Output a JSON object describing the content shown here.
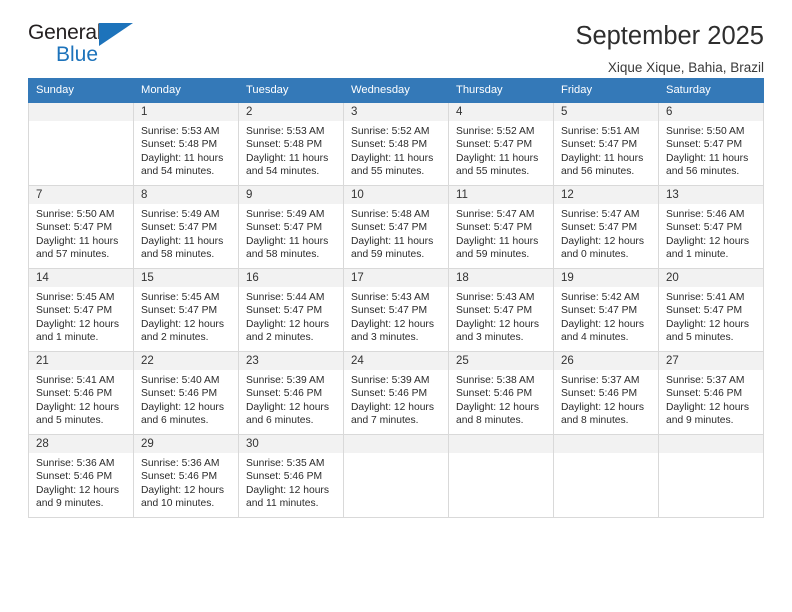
{
  "brand": {
    "name_top": "General",
    "name_bottom": "Blue",
    "triangle_icon": "triangle-icon",
    "accent_color": "#1d73bb"
  },
  "header": {
    "title": "September 2025",
    "subtitle": "Xique Xique, Bahia, Brazil"
  },
  "calendar": {
    "header_bg": "#3479b8",
    "daynum_bg": "#f2f2f2",
    "weekdays": [
      "Sunday",
      "Monday",
      "Tuesday",
      "Wednesday",
      "Thursday",
      "Friday",
      "Saturday"
    ],
    "weeks": [
      [
        {
          "day": "",
          "empty": true,
          "sunrise": "",
          "sunset": "",
          "daylight_1": "",
          "daylight_2": ""
        },
        {
          "day": "1",
          "sunrise": "Sunrise: 5:53 AM",
          "sunset": "Sunset: 5:48 PM",
          "daylight_1": "Daylight: 11 hours",
          "daylight_2": "and 54 minutes."
        },
        {
          "day": "2",
          "sunrise": "Sunrise: 5:53 AM",
          "sunset": "Sunset: 5:48 PM",
          "daylight_1": "Daylight: 11 hours",
          "daylight_2": "and 54 minutes."
        },
        {
          "day": "3",
          "sunrise": "Sunrise: 5:52 AM",
          "sunset": "Sunset: 5:48 PM",
          "daylight_1": "Daylight: 11 hours",
          "daylight_2": "and 55 minutes."
        },
        {
          "day": "4",
          "sunrise": "Sunrise: 5:52 AM",
          "sunset": "Sunset: 5:47 PM",
          "daylight_1": "Daylight: 11 hours",
          "daylight_2": "and 55 minutes."
        },
        {
          "day": "5",
          "sunrise": "Sunrise: 5:51 AM",
          "sunset": "Sunset: 5:47 PM",
          "daylight_1": "Daylight: 11 hours",
          "daylight_2": "and 56 minutes."
        },
        {
          "day": "6",
          "sunrise": "Sunrise: 5:50 AM",
          "sunset": "Sunset: 5:47 PM",
          "daylight_1": "Daylight: 11 hours",
          "daylight_2": "and 56 minutes."
        }
      ],
      [
        {
          "day": "7",
          "sunrise": "Sunrise: 5:50 AM",
          "sunset": "Sunset: 5:47 PM",
          "daylight_1": "Daylight: 11 hours",
          "daylight_2": "and 57 minutes."
        },
        {
          "day": "8",
          "sunrise": "Sunrise: 5:49 AM",
          "sunset": "Sunset: 5:47 PM",
          "daylight_1": "Daylight: 11 hours",
          "daylight_2": "and 58 minutes."
        },
        {
          "day": "9",
          "sunrise": "Sunrise: 5:49 AM",
          "sunset": "Sunset: 5:47 PM",
          "daylight_1": "Daylight: 11 hours",
          "daylight_2": "and 58 minutes."
        },
        {
          "day": "10",
          "sunrise": "Sunrise: 5:48 AM",
          "sunset": "Sunset: 5:47 PM",
          "daylight_1": "Daylight: 11 hours",
          "daylight_2": "and 59 minutes."
        },
        {
          "day": "11",
          "sunrise": "Sunrise: 5:47 AM",
          "sunset": "Sunset: 5:47 PM",
          "daylight_1": "Daylight: 11 hours",
          "daylight_2": "and 59 minutes."
        },
        {
          "day": "12",
          "sunrise": "Sunrise: 5:47 AM",
          "sunset": "Sunset: 5:47 PM",
          "daylight_1": "Daylight: 12 hours",
          "daylight_2": "and 0 minutes."
        },
        {
          "day": "13",
          "sunrise": "Sunrise: 5:46 AM",
          "sunset": "Sunset: 5:47 PM",
          "daylight_1": "Daylight: 12 hours",
          "daylight_2": "and 1 minute."
        }
      ],
      [
        {
          "day": "14",
          "sunrise": "Sunrise: 5:45 AM",
          "sunset": "Sunset: 5:47 PM",
          "daylight_1": "Daylight: 12 hours",
          "daylight_2": "and 1 minute."
        },
        {
          "day": "15",
          "sunrise": "Sunrise: 5:45 AM",
          "sunset": "Sunset: 5:47 PM",
          "daylight_1": "Daylight: 12 hours",
          "daylight_2": "and 2 minutes."
        },
        {
          "day": "16",
          "sunrise": "Sunrise: 5:44 AM",
          "sunset": "Sunset: 5:47 PM",
          "daylight_1": "Daylight: 12 hours",
          "daylight_2": "and 2 minutes."
        },
        {
          "day": "17",
          "sunrise": "Sunrise: 5:43 AM",
          "sunset": "Sunset: 5:47 PM",
          "daylight_1": "Daylight: 12 hours",
          "daylight_2": "and 3 minutes."
        },
        {
          "day": "18",
          "sunrise": "Sunrise: 5:43 AM",
          "sunset": "Sunset: 5:47 PM",
          "daylight_1": "Daylight: 12 hours",
          "daylight_2": "and 3 minutes."
        },
        {
          "day": "19",
          "sunrise": "Sunrise: 5:42 AM",
          "sunset": "Sunset: 5:47 PM",
          "daylight_1": "Daylight: 12 hours",
          "daylight_2": "and 4 minutes."
        },
        {
          "day": "20",
          "sunrise": "Sunrise: 5:41 AM",
          "sunset": "Sunset: 5:47 PM",
          "daylight_1": "Daylight: 12 hours",
          "daylight_2": "and 5 minutes."
        }
      ],
      [
        {
          "day": "21",
          "sunrise": "Sunrise: 5:41 AM",
          "sunset": "Sunset: 5:46 PM",
          "daylight_1": "Daylight: 12 hours",
          "daylight_2": "and 5 minutes."
        },
        {
          "day": "22",
          "sunrise": "Sunrise: 5:40 AM",
          "sunset": "Sunset: 5:46 PM",
          "daylight_1": "Daylight: 12 hours",
          "daylight_2": "and 6 minutes."
        },
        {
          "day": "23",
          "sunrise": "Sunrise: 5:39 AM",
          "sunset": "Sunset: 5:46 PM",
          "daylight_1": "Daylight: 12 hours",
          "daylight_2": "and 6 minutes."
        },
        {
          "day": "24",
          "sunrise": "Sunrise: 5:39 AM",
          "sunset": "Sunset: 5:46 PM",
          "daylight_1": "Daylight: 12 hours",
          "daylight_2": "and 7 minutes."
        },
        {
          "day": "25",
          "sunrise": "Sunrise: 5:38 AM",
          "sunset": "Sunset: 5:46 PM",
          "daylight_1": "Daylight: 12 hours",
          "daylight_2": "and 8 minutes."
        },
        {
          "day": "26",
          "sunrise": "Sunrise: 5:37 AM",
          "sunset": "Sunset: 5:46 PM",
          "daylight_1": "Daylight: 12 hours",
          "daylight_2": "and 8 minutes."
        },
        {
          "day": "27",
          "sunrise": "Sunrise: 5:37 AM",
          "sunset": "Sunset: 5:46 PM",
          "daylight_1": "Daylight: 12 hours",
          "daylight_2": "and 9 minutes."
        }
      ],
      [
        {
          "day": "28",
          "sunrise": "Sunrise: 5:36 AM",
          "sunset": "Sunset: 5:46 PM",
          "daylight_1": "Daylight: 12 hours",
          "daylight_2": "and 9 minutes."
        },
        {
          "day": "29",
          "sunrise": "Sunrise: 5:36 AM",
          "sunset": "Sunset: 5:46 PM",
          "daylight_1": "Daylight: 12 hours",
          "daylight_2": "and 10 minutes."
        },
        {
          "day": "30",
          "sunrise": "Sunrise: 5:35 AM",
          "sunset": "Sunset: 5:46 PM",
          "daylight_1": "Daylight: 12 hours",
          "daylight_2": "and 11 minutes."
        },
        {
          "day": "",
          "empty": true,
          "sunrise": "",
          "sunset": "",
          "daylight_1": "",
          "daylight_2": ""
        },
        {
          "day": "",
          "empty": true,
          "sunrise": "",
          "sunset": "",
          "daylight_1": "",
          "daylight_2": ""
        },
        {
          "day": "",
          "empty": true,
          "sunrise": "",
          "sunset": "",
          "daylight_1": "",
          "daylight_2": ""
        },
        {
          "day": "",
          "empty": true,
          "sunrise": "",
          "sunset": "",
          "daylight_1": "",
          "daylight_2": ""
        }
      ]
    ]
  }
}
